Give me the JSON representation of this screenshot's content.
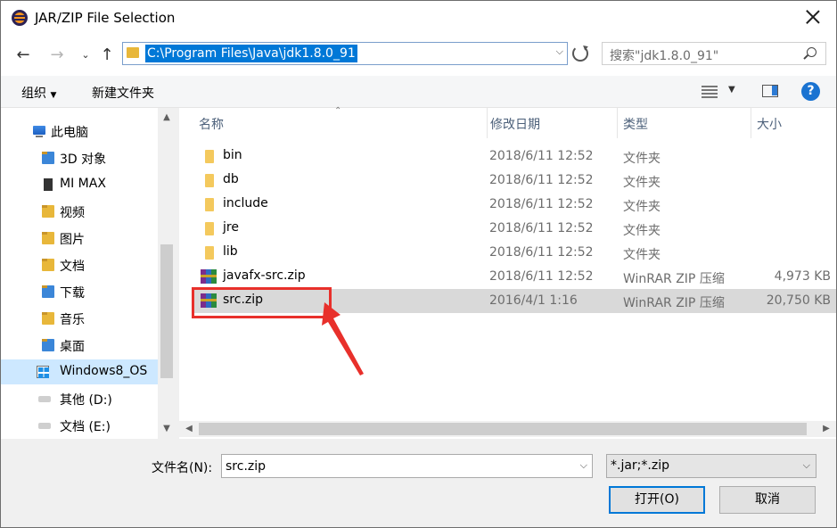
{
  "window": {
    "title": "JAR/ZIP File Selection"
  },
  "address": {
    "path": "C:\\Program Files\\Java\\jdk1.8.0_91"
  },
  "search": {
    "placeholder": "搜索\"jdk1.8.0_91\""
  },
  "toolbar": {
    "organize": "组织",
    "new_folder": "新建文件夹"
  },
  "nav": {
    "items": [
      {
        "label": "此电脑",
        "icon": "computer-icon"
      },
      {
        "label": "3D 对象",
        "icon": "folder-icon"
      },
      {
        "label": "MI MAX",
        "icon": "phone-icon"
      },
      {
        "label": "视频",
        "icon": "folder-icon"
      },
      {
        "label": "图片",
        "icon": "folder-icon"
      },
      {
        "label": "文档",
        "icon": "folder-icon"
      },
      {
        "label": "下载",
        "icon": "download-folder-icon"
      },
      {
        "label": "音乐",
        "icon": "folder-icon"
      },
      {
        "label": "桌面",
        "icon": "folder-icon"
      },
      {
        "label": "Windows8_OS",
        "icon": "windows-drive-icon",
        "selected": true
      },
      {
        "label": "其他 (D:)",
        "icon": "drive-icon"
      },
      {
        "label": "文档 (E:)",
        "icon": "drive-icon"
      }
    ]
  },
  "columns": {
    "name": "名称",
    "modified": "修改日期",
    "type": "类型",
    "size": "大小"
  },
  "files": [
    {
      "name": "bin",
      "modified": "2018/6/11 12:52",
      "type": "文件夹",
      "size": "",
      "icon": "folder-icon"
    },
    {
      "name": "db",
      "modified": "2018/6/11 12:52",
      "type": "文件夹",
      "size": "",
      "icon": "folder-icon"
    },
    {
      "name": "include",
      "modified": "2018/6/11 12:52",
      "type": "文件夹",
      "size": "",
      "icon": "folder-icon"
    },
    {
      "name": "jre",
      "modified": "2018/6/11 12:52",
      "type": "文件夹",
      "size": "",
      "icon": "folder-icon"
    },
    {
      "name": "lib",
      "modified": "2018/6/11 12:52",
      "type": "文件夹",
      "size": "",
      "icon": "folder-icon"
    },
    {
      "name": "javafx-src.zip",
      "modified": "2018/6/11 12:52",
      "type": "WinRAR ZIP 压缩",
      "size": "4,973 KB",
      "icon": "winrar-zip-icon"
    },
    {
      "name": "src.zip",
      "modified": "2016/4/1 1:16",
      "type": "WinRAR ZIP 压缩",
      "size": "20,750 KB",
      "icon": "winrar-zip-icon",
      "selected": true
    }
  ],
  "bottom": {
    "filename_label": "文件名(N):",
    "filename_value": "src.zip",
    "filter_value": "*.jar;*.zip",
    "open_label": "打开(O)",
    "cancel_label": "取消"
  },
  "colors": {
    "accent": "#0078d7",
    "annotation": "#e8302b",
    "selection": "#cde8ff"
  }
}
